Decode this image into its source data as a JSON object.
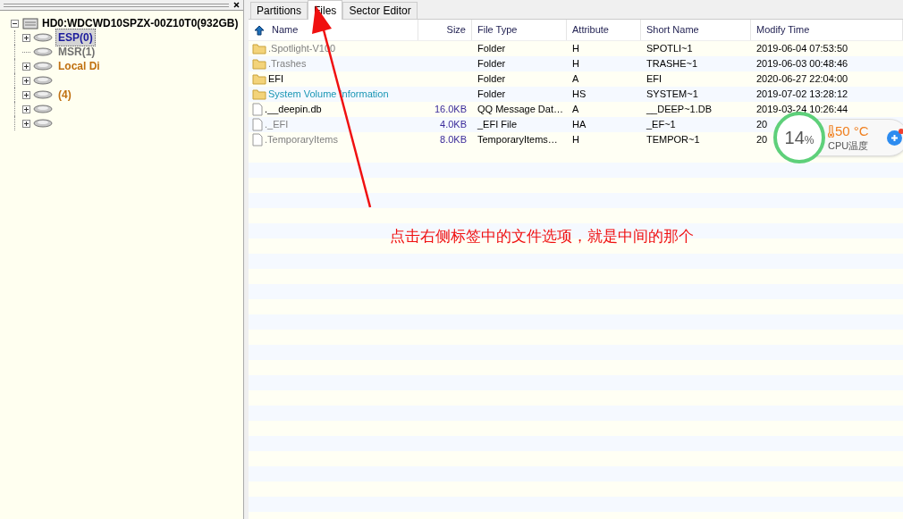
{
  "tree": {
    "root": {
      "label": "HD0:WDCWD10SPZX-00Z10T0(932GB)",
      "expanded": true,
      "children": [
        {
          "label": "ESP(0)",
          "expandable": true,
          "selected": true,
          "color": "#1a1a9c"
        },
        {
          "label": "MSR(1)",
          "expandable": false,
          "selected": false,
          "color": "#707070"
        },
        {
          "label": "Local Di",
          "expandable": true,
          "selected": false,
          "color": "#c07010"
        },
        {
          "expandable": true
        },
        {
          "label": "(4)",
          "expandable": true,
          "selected": false,
          "color": "#c07010"
        },
        {
          "expandable": true
        },
        {
          "expandable": true
        }
      ]
    }
  },
  "tabs": [
    {
      "label": "Partitions",
      "selected": false
    },
    {
      "label": "Files",
      "selected": true
    },
    {
      "label": "Sector Editor",
      "selected": false
    }
  ],
  "table": {
    "columns": [
      "Name",
      "Size",
      "File Type",
      "Attribute",
      "Short Name",
      "Modify Time"
    ],
    "rows": [
      {
        "kind": "folder",
        "name": ".Spotlight-V100",
        "color": "#808080",
        "size": "",
        "type": "Folder",
        "attr": "H",
        "short": "SPOTLI~1",
        "time": "2019-06-04 07:53:50"
      },
      {
        "kind": "folder",
        "name": ".Trashes",
        "color": "#808080",
        "size": "",
        "type": "Folder",
        "attr": "H",
        "short": "TRASHE~1",
        "time": "2019-06-03 00:48:46"
      },
      {
        "kind": "folder",
        "name": "EFI",
        "color": "#000000",
        "size": "",
        "type": "Folder",
        "attr": "A",
        "short": "EFI",
        "time": "2020-06-27 22:04:00"
      },
      {
        "kind": "folder",
        "name": "System Volume Information",
        "color": "#1a96b4",
        "size": "",
        "type": "Folder",
        "attr": "HS",
        "short": "SYSTEM~1",
        "time": "2019-07-02 13:28:12"
      },
      {
        "kind": "file",
        "name": ".__deepin.db",
        "color": "#000000",
        "size": "16.0KB",
        "type": "QQ Message Dat…",
        "attr": "A",
        "short": "__DEEP~1.DB",
        "time": "2019-03-24 10:26:44"
      },
      {
        "kind": "file",
        "name": "._EFI",
        "color": "#808080",
        "size": "4.0KB",
        "type": "_EFI File",
        "attr": "HA",
        "short": "_EF~1",
        "time": "20"
      },
      {
        "kind": "file",
        "name": ".TemporaryItems",
        "color": "#808080",
        "size": "8.0KB",
        "type": "TemporaryItems…",
        "attr": "H",
        "short": "TEMPOR~1",
        "time": "20"
      }
    ]
  },
  "annotation": {
    "text": "点击右侧标签中的文件选项，就是中间的那个"
  },
  "cpu_widget": {
    "usage": "14",
    "unit": "%",
    "temperature": "50 °C",
    "label": "CPU温度"
  }
}
